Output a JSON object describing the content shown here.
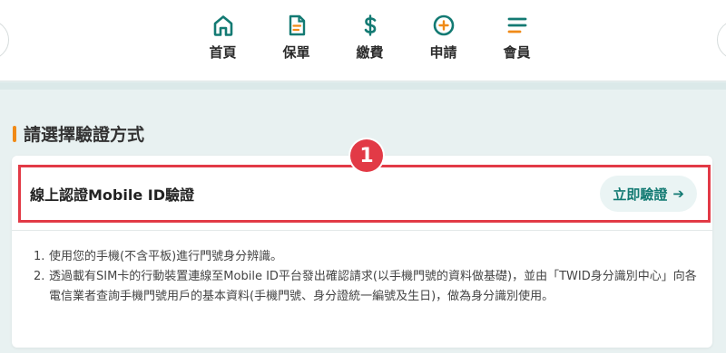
{
  "nav": {
    "items": [
      {
        "label": "首頁",
        "icon": "home-icon"
      },
      {
        "label": "保單",
        "icon": "policy-document-icon"
      },
      {
        "label": "繳費",
        "icon": "dollar-icon"
      },
      {
        "label": "申請",
        "icon": "plus-circle-icon"
      },
      {
        "label": "會員",
        "icon": "menu-icon"
      }
    ],
    "icon_color": "#137a73"
  },
  "section": {
    "title": "請選擇驗證方式",
    "accent": "#f08a17"
  },
  "method": {
    "label": "線上認證Mobile ID驗證",
    "button_label": "立即驗證",
    "button_arrow": "➔",
    "highlight_color": "#e23a46"
  },
  "badge": {
    "number": "1"
  },
  "notes": [
    {
      "num": "1.",
      "text": "使用您的手機(不含平板)進行門號身分辨識。"
    },
    {
      "num": "2.",
      "text": "透過載有SIM卡的行動裝置連線至Mobile ID平台發出確認請求(以手機門號的資料做基礎)，並由「TWID身分識別中心」向各電信業者查詢手機門號用戶的基本資料(手機門號、身分證統一編號及生日)，做為身分識別使用。"
    }
  ]
}
